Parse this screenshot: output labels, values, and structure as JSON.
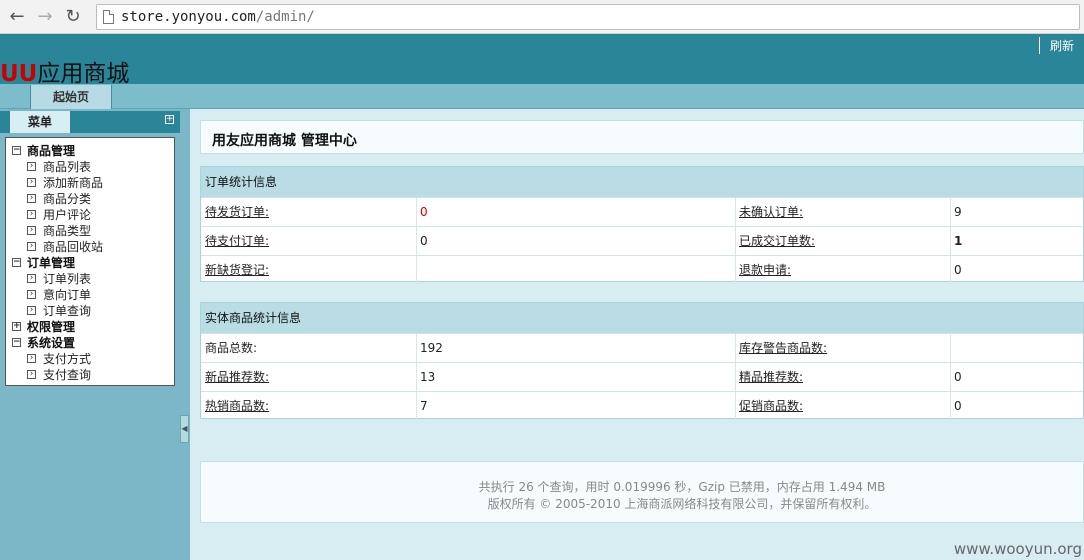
{
  "browser": {
    "url_host": "store.yonyou.com",
    "url_path": "/admin/"
  },
  "header": {
    "logo_prefix": "UU",
    "logo_text": "应用商城",
    "refresh_label": "刷新"
  },
  "tabs": {
    "start_label": "起始页"
  },
  "sidebar": {
    "menu_label": "菜单",
    "toggle_symbol": "+",
    "groups": [
      {
        "label": "商品管理",
        "items": [
          "商品列表",
          "添加新商品",
          "商品分类",
          "用户评论",
          "商品类型",
          "商品回收站"
        ]
      },
      {
        "label": "订单管理",
        "items": [
          "订单列表",
          "意向订单",
          "订单查询"
        ]
      },
      {
        "label": "权限管理",
        "items": []
      },
      {
        "label": "系统设置",
        "items": [
          "支付方式",
          "支付查询"
        ]
      }
    ]
  },
  "main": {
    "title": "用友应用商城 管理中心",
    "order_panel": {
      "heading": "订单统计信息",
      "rows": [
        [
          "待发货订单:",
          "0",
          "未确认订单:",
          "9"
        ],
        [
          "待支付订单:",
          "0",
          "已成交订单数:",
          "1"
        ],
        [
          "新缺货登记:",
          "",
          "退款申请:",
          "0"
        ]
      ]
    },
    "goods_panel": {
      "heading": "实体商品统计信息",
      "rows": [
        [
          "商品总数:",
          "192",
          "库存警告商品数:",
          ""
        ],
        [
          "新品推荐数:",
          "13",
          "精品推荐数:",
          "0"
        ],
        [
          "热销商品数:",
          "7",
          "促销商品数:",
          "0"
        ]
      ]
    },
    "footer_line1": "共执行 26 个查询，用时 0.019996 秒，Gzip 已禁用，内存占用 1.494 MB",
    "footer_line2": "版权所有 © 2005-2010 上海商派网络科技有限公司，并保留所有权利。"
  },
  "watermark": "www.wooyun.org",
  "colors": {
    "header": "#2a8598",
    "sidebar": "#7cb7c8",
    "main_bg": "#d7edf2",
    "panel_head": "#b9dce5",
    "logo_accent": "#cc0000",
    "alert": "#dd0000"
  }
}
